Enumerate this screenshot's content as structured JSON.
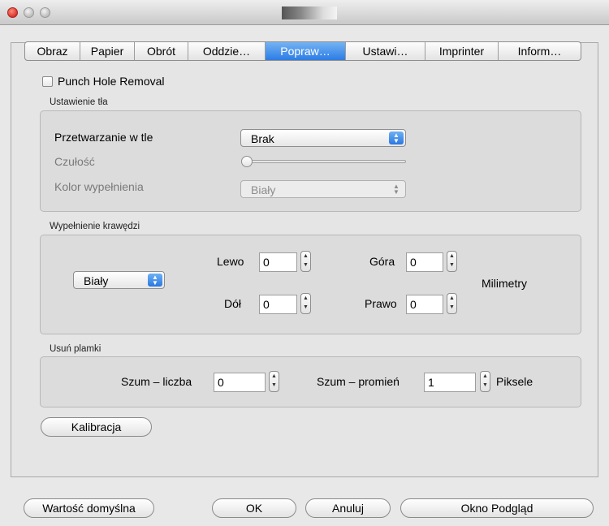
{
  "tabs": [
    "Obraz",
    "Papier",
    "Obrót",
    "Oddzie…",
    "Popraw…",
    "Ustawi…",
    "Imprinter",
    "Inform…"
  ],
  "active_tab": "Popraw…",
  "punch_hole": {
    "label": "Punch Hole Removal",
    "checked": false
  },
  "background": {
    "group_title": "Ustawienie tła",
    "processing_label": "Przetwarzanie w tle",
    "processing_value": "Brak",
    "sensitivity_label": "Czułość",
    "fill_color_label": "Kolor wypełnienia",
    "fill_color_value": "Biały"
  },
  "edge_fill": {
    "group_title": "Wypełnienie krawędzi",
    "color_value": "Biały",
    "left_label": "Lewo",
    "left_value": "0",
    "top_label": "Góra",
    "top_value": "0",
    "bottom_label": "Dół",
    "bottom_value": "0",
    "right_label": "Prawo",
    "right_value": "0",
    "unit_label": "Milimetry"
  },
  "despeckle": {
    "group_title": "Usuń plamki",
    "noise_count_label": "Szum – liczba",
    "noise_count_value": "0",
    "noise_radius_label": "Szum – promień",
    "noise_radius_value": "1",
    "unit_label": "Piksele"
  },
  "buttons": {
    "calibration": "Kalibracja",
    "default": "Wartość domyślna",
    "ok": "OK",
    "cancel": "Anuluj",
    "preview": "Okno Podgląd"
  }
}
